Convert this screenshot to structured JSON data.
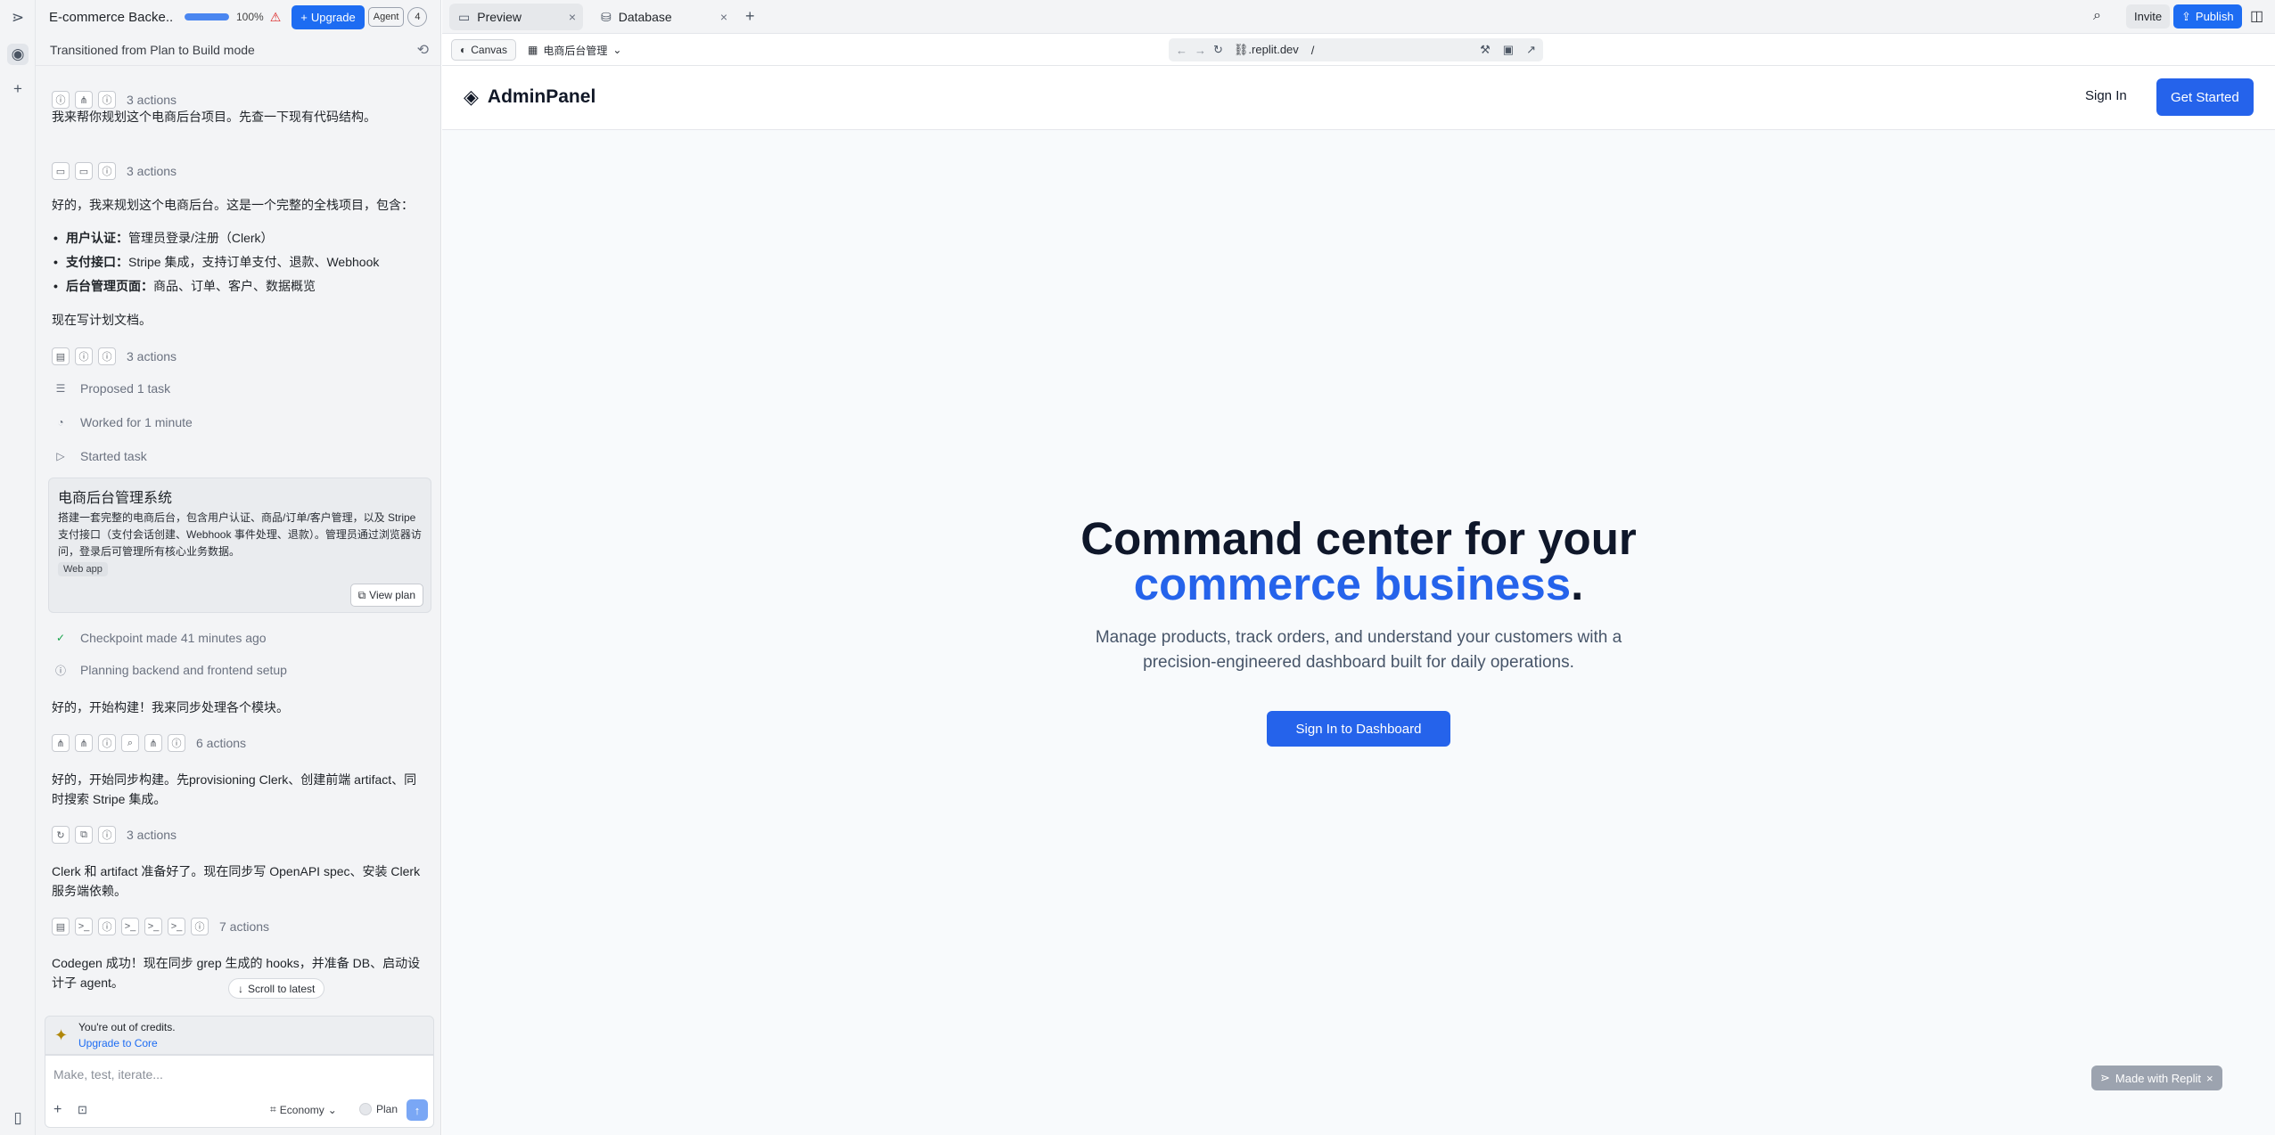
{
  "project": {
    "title": "E-commerce Backe...",
    "progress_label": "100%",
    "progress_value": 1.0,
    "upgrade_label": "Upgrade",
    "agent_label": "Agent",
    "agent_count": "4"
  },
  "mode_banner": "Transitioned from Plan to Build mode",
  "messages": {
    "a1": "3 actions",
    "t1": "我来帮你规划这个电商后台项目。先查一下现有代码结构。",
    "a2": "3 actions",
    "t2": "好的，我来规划这个电商后台。这是一个完整的全栈项目，包含：",
    "bullets": [
      {
        "head": "用户认证：",
        "text": "管理员登录/注册（Clerk）"
      },
      {
        "head": "支付接口：",
        "text": "Stripe 集成，支持订单支付、退款、Webhook"
      },
      {
        "head": "后台管理页面：",
        "text": "商品、订单、客户、数据概览"
      }
    ],
    "t3": "现在写计划文档。",
    "a3": "3 actions",
    "s1": "Proposed 1 task",
    "s2": "Worked for 1 minute",
    "s3": "Started task",
    "plan": {
      "title": "电商后台管理系统",
      "desc": "搭建一套完整的电商后台，包含用户认证、商品/订单/客户管理，以及 Stripe 支付接口（支付会话创建、Webhook 事件处理、退款）。管理员通过浏览器访问，登录后可管理所有核心业务数据。",
      "tag": "Web app",
      "button": "View plan"
    },
    "s4": "Checkpoint made 41 minutes ago",
    "s5": "Planning backend and frontend setup",
    "t4": "好的，开始构建！我来同步处理各个模块。",
    "a4": "6 actions",
    "t5": "好的，开始同步构建。先provisioning Clerk、创建前端 artifact、同时搜索 Stripe 集成。",
    "a5": "3 actions",
    "t6": "Clerk 和 artifact 准备好了。现在同步写 OpenAPI spec、安装 Clerk 服务端依赖。",
    "a6": "7 actions",
    "t7": "Codegen 成功！现在同步 grep 生成的 hooks，并准备 DB、启动设计子 agent。"
  },
  "scroll_latest": "Scroll to latest",
  "credits": {
    "line1": "You're out of credits.",
    "line2": "Upgrade to Core"
  },
  "composer": {
    "placeholder": "Make, test, iterate...",
    "mode": "Economy",
    "plan_label": "Plan"
  },
  "tabs": [
    {
      "label": "Preview",
      "icon": "monitor-icon"
    },
    {
      "label": "Database",
      "icon": "database-icon"
    }
  ],
  "topbar": {
    "invite": "Invite",
    "publish": "Publish"
  },
  "preview_toolbar": {
    "canvas": "Canvas",
    "app_name": "电商后台管理",
    "url_host": ".replit.dev",
    "url_path": "/"
  },
  "site": {
    "brand": "AdminPanel",
    "signin": "Sign In",
    "get_started": "Get Started",
    "hero_line1": "Command center for your",
    "hero_accent": "commerce business",
    "hero_period": ".",
    "hero_sub": "Manage products, track orders, and understand your customers with a precision-engineered dashboard built for daily operations.",
    "cta": "Sign In to Dashboard"
  },
  "made_with": "Made with Replit",
  "colors": {
    "accent": "#2563eb",
    "replit_blue": "#1d6cf2",
    "hero_text": "#0f172a",
    "warning": "#dc2626"
  }
}
